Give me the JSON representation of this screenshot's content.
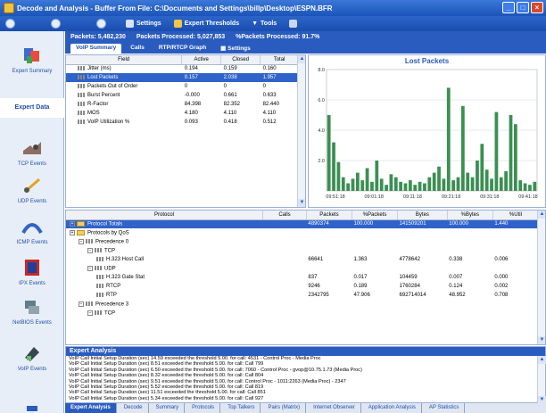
{
  "window": {
    "title": "Decode and Analysis - Buffer From File:  C:\\Documents and Settings\\billp\\Desktop\\ESPN.BFR"
  },
  "toolbar": {
    "settings_label": "Settings",
    "expert_thresholds_label": "Expert Thresholds",
    "tools_label": "Tools"
  },
  "sidebar": {
    "items": [
      {
        "label": "Expert Summary",
        "icon": "expert-summary-icon"
      },
      {
        "label": "Expert Data",
        "icon": ""
      },
      {
        "label": "TCP Events",
        "icon": "tcp-events-icon"
      },
      {
        "label": "UDP Events",
        "icon": "udp-events-icon"
      },
      {
        "label": "ICMP Events",
        "icon": "icmp-events-icon"
      },
      {
        "label": "IPX Events",
        "icon": "ipx-events-icon"
      },
      {
        "label": "NetBIOS Events",
        "icon": "netbios-events-icon"
      },
      {
        "label": "VoIP Events",
        "icon": "voip-events-icon"
      }
    ]
  },
  "stats": {
    "packets": "Packets: 5,482,230",
    "processed": "Packets Processed: 5,027,853",
    "percent": "%Packets Processed: 91.7%"
  },
  "tabs": [
    "VoIP Summary",
    "Calls",
    "RTP/RTCP Graph",
    "Settings"
  ],
  "metrics": {
    "headers": [
      "Field",
      "Active",
      "Closed",
      "Total"
    ],
    "rows": [
      {
        "field": "Jitter (ms)",
        "active": "0.194",
        "closed": "0.159",
        "total": "0.160"
      },
      {
        "field": "Lost Packets",
        "active": "0.157",
        "closed": "2.038",
        "total": "1.957"
      },
      {
        "field": "Packets Out of Order",
        "active": "0",
        "closed": "0",
        "total": "0"
      },
      {
        "field": "Burst Percent",
        "active": "-0.000",
        "closed": "0.661",
        "total": "0.633"
      },
      {
        "field": "R-Factor",
        "active": "84.398",
        "closed": "82.352",
        "total": "82.440"
      },
      {
        "field": "MOS",
        "active": "4.180",
        "closed": "4.110",
        "total": "4.110"
      },
      {
        "field": "VoIP Utilization %",
        "active": "0.093",
        "closed": "0.418",
        "total": "0.512"
      }
    ]
  },
  "chart_data": {
    "type": "bar",
    "title": "Lost Packets",
    "xlabel": "",
    "ylabel": "",
    "ylim": [
      0,
      8.0
    ],
    "yticks": [
      "8.0",
      "6.0",
      "4.0",
      "2.0"
    ],
    "xticks": [
      "09:51:18",
      "09:01:18",
      "09:11:18",
      "09:21:18",
      "09:31:18",
      "09:41:18"
    ],
    "values": [
      5.0,
      3.2,
      1.9,
      0.9,
      0.5,
      0.8,
      1.2,
      0.7,
      1.5,
      0.6,
      2.0,
      0.8,
      0.4,
      1.1,
      0.9,
      0.6,
      0.5,
      0.7,
      0.4,
      0.6,
      0.5,
      0.9,
      1.2,
      1.6,
      0.8,
      6.8,
      0.7,
      0.9,
      5.6,
      1.2,
      0.9,
      2.0,
      3.1,
      1.4,
      0.8,
      5.2,
      0.9,
      1.3,
      5.0,
      4.4,
      0.7,
      0.5,
      0.4,
      0.6
    ],
    "grid": true,
    "color": "#3a8f52"
  },
  "protocol": {
    "headers": [
      "Protocol",
      "Calls",
      "Packets",
      "%Packets",
      "Bytes",
      "%Bytes",
      "%Util"
    ],
    "rows": [
      {
        "name": "Protocol Totals",
        "calls": "",
        "packets": "4890374",
        "ppackets": "100.000",
        "bytes": "141509201",
        "pbytes": "100.000",
        "util": "1.440",
        "level": 0,
        "kind": "folder",
        "sel": true
      },
      {
        "name": "Protocols by QoS",
        "calls": "",
        "packets": "",
        "ppackets": "",
        "bytes": "",
        "pbytes": "",
        "util": "",
        "level": 0,
        "kind": "folder"
      },
      {
        "name": "Precedence 0",
        "calls": "",
        "packets": "",
        "ppackets": "",
        "bytes": "",
        "pbytes": "",
        "util": "",
        "level": 1,
        "kind": "group"
      },
      {
        "name": "TCP",
        "calls": "",
        "packets": "",
        "ppackets": "",
        "bytes": "",
        "pbytes": "",
        "util": "",
        "level": 2,
        "kind": "group"
      },
      {
        "name": "H.323 Host Call",
        "calls": "",
        "packets": "66641",
        "ppackets": "1.363",
        "bytes": "4778642",
        "pbytes": "0.338",
        "util": "0.006",
        "level": 3,
        "kind": "leaf"
      },
      {
        "name": "UDP",
        "calls": "",
        "packets": "",
        "ppackets": "",
        "bytes": "",
        "pbytes": "",
        "util": "",
        "level": 2,
        "kind": "group"
      },
      {
        "name": "H.323 Gate Stat",
        "calls": "",
        "packets": "837",
        "ppackets": "0.017",
        "bytes": "104459",
        "pbytes": "0.007",
        "util": "0.000",
        "level": 3,
        "kind": "leaf"
      },
      {
        "name": "RTCP",
        "calls": "",
        "packets": "9246",
        "ppackets": "0.189",
        "bytes": "1760284",
        "pbytes": "0.124",
        "util": "0.002",
        "level": 3,
        "kind": "leaf"
      },
      {
        "name": "RTP",
        "calls": "",
        "packets": "2342795",
        "ppackets": "47.906",
        "bytes": "692714014",
        "pbytes": "48.952",
        "util": "0.708",
        "level": 3,
        "kind": "leaf"
      },
      {
        "name": "Precedence 3",
        "calls": "",
        "packets": "",
        "ppackets": "",
        "bytes": "",
        "pbytes": "",
        "util": "",
        "level": 1,
        "kind": "group"
      },
      {
        "name": "TCP",
        "calls": "",
        "packets": "",
        "ppackets": "",
        "bytes": "",
        "pbytes": "",
        "util": "",
        "level": 2,
        "kind": "group"
      }
    ]
  },
  "expert": {
    "title": "Expert Analysis",
    "lines": [
      "VoIP Call Initial Setup Duration (sec) 14.59 exceeded the threshold 5.00. for call: 4531 - Control Proc - Media Proc",
      "VoIP Call Initial Setup Duration (sec) 8.51 exceeded the threshold 5.00. for call: Call 799",
      "VoIP Call Initial Setup Duration (sec) 6.50 exceeded the threshold 5.00. for call: 7060 - Control Proc - gvop@10.75.1.73 (Media Proc)",
      "VoIP Call Initial Setup Duration (sec) 8.32 exceeded the threshold 5.00. for call: Call 804",
      "VoIP Call Initial Setup Duration (sec) 9.51 exceeded the threshold 5.00. for call: Control Proc - 1011:2263 (Media Proc) - 2347",
      "VoIP Call Initial Setup Duration (sec) 5.52 exceeded the threshold 5.00. for call: Call 819",
      "VoIP Call Initial Setup Duration (sec) 11.51 exceeded the threshold 5.00. for call: Call 851",
      "VoIP Call Initial Setup Duration (sec) 5.34 exceeded the threshold 5.00. for call: Call 927"
    ]
  },
  "bottom_tabs": [
    "Expert Analysis",
    "Decode",
    "Summary",
    "Protocols",
    "Top Talkers",
    "Pairs (Matrix)",
    "Internet Observer",
    "Application Analysis",
    "AP Statistics"
  ]
}
